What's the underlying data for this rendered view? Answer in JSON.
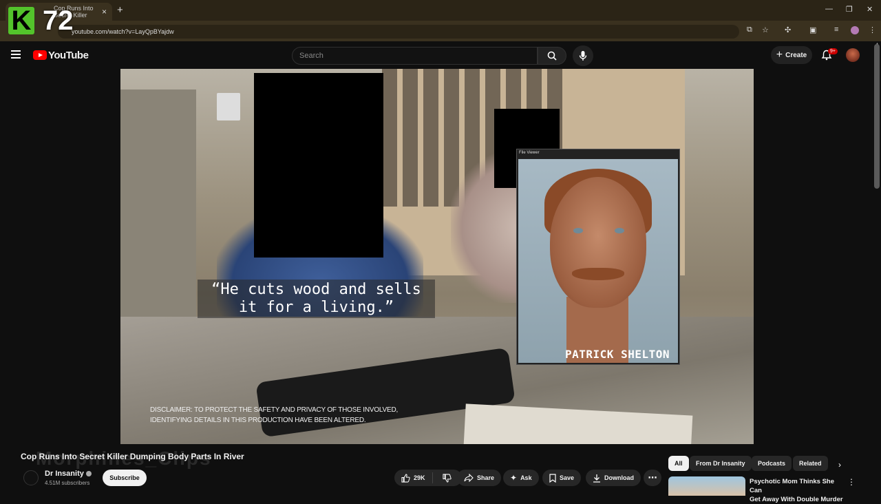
{
  "browser": {
    "tab_title": "Cop Runs Into Secret Killer",
    "new_tab": "+",
    "url": "youtube.com/watch?v=LayQpBYajdw",
    "overlay_letter": "K",
    "overlay_number": "72"
  },
  "header": {
    "brand": "YouTube",
    "search_placeholder": "Search",
    "create_label": "Create",
    "notification_badge": "9+"
  },
  "video": {
    "caption_line1": "“He cuts wood and sells",
    "caption_line2": "it for a living.”",
    "disclaimer_line1": "DISCLAIMER: TO PROTECT THE SAFETY AND PRIVACY OF THOSE INVOLVED,",
    "disclaimer_line2": "IDENTIFYING DETAILS IN THIS PRODUCTION HAVE BEEN ALTERED.",
    "file_viewer_title": "File Viewer",
    "mugshot_name": "PATRICK SHELTON"
  },
  "info": {
    "title": "Cop Runs Into Secret Killer Dumping Body Parts In River",
    "watermark": "Morphines_Clips",
    "channel_name": "Dr Insanity",
    "subscribers": "4.51M subscribers",
    "subscribe_label": "Subscribe",
    "likes": "29K",
    "share_label": "Share",
    "ask_label": "Ask",
    "save_label": "Save",
    "download_label": "Download"
  },
  "chips": [
    "All",
    "From Dr Insanity",
    "Podcasts",
    "Related"
  ],
  "recommendation": {
    "title_line1": "Psychotic Mom Thinks She Can",
    "title_line2": "Get Away With Double Murder"
  },
  "colors": {
    "background": "#0f0f0f",
    "brand_red": "#ff0000",
    "chrome": "#2b2416",
    "overlay_green": "#53c32b"
  }
}
